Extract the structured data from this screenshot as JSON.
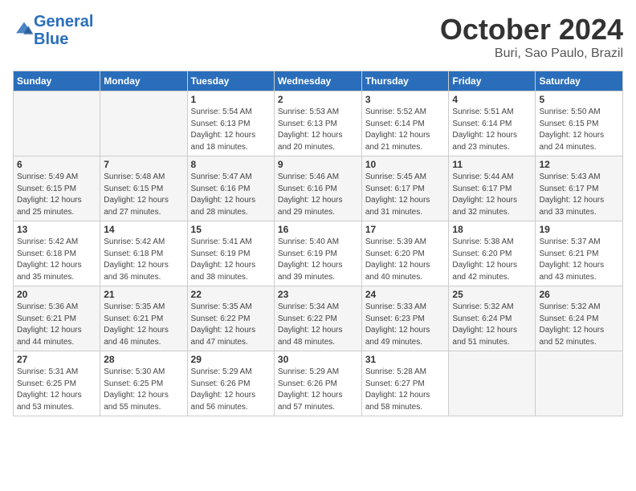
{
  "logo": {
    "line1": "General",
    "line2": "Blue"
  },
  "title": "October 2024",
  "subtitle": "Buri, Sao Paulo, Brazil",
  "days_of_week": [
    "Sunday",
    "Monday",
    "Tuesday",
    "Wednesday",
    "Thursday",
    "Friday",
    "Saturday"
  ],
  "weeks": [
    [
      {
        "num": "",
        "info": ""
      },
      {
        "num": "",
        "info": ""
      },
      {
        "num": "1",
        "info": "Sunrise: 5:54 AM\nSunset: 6:13 PM\nDaylight: 12 hours\nand 18 minutes."
      },
      {
        "num": "2",
        "info": "Sunrise: 5:53 AM\nSunset: 6:13 PM\nDaylight: 12 hours\nand 20 minutes."
      },
      {
        "num": "3",
        "info": "Sunrise: 5:52 AM\nSunset: 6:14 PM\nDaylight: 12 hours\nand 21 minutes."
      },
      {
        "num": "4",
        "info": "Sunrise: 5:51 AM\nSunset: 6:14 PM\nDaylight: 12 hours\nand 23 minutes."
      },
      {
        "num": "5",
        "info": "Sunrise: 5:50 AM\nSunset: 6:15 PM\nDaylight: 12 hours\nand 24 minutes."
      }
    ],
    [
      {
        "num": "6",
        "info": "Sunrise: 5:49 AM\nSunset: 6:15 PM\nDaylight: 12 hours\nand 25 minutes."
      },
      {
        "num": "7",
        "info": "Sunrise: 5:48 AM\nSunset: 6:15 PM\nDaylight: 12 hours\nand 27 minutes."
      },
      {
        "num": "8",
        "info": "Sunrise: 5:47 AM\nSunset: 6:16 PM\nDaylight: 12 hours\nand 28 minutes."
      },
      {
        "num": "9",
        "info": "Sunrise: 5:46 AM\nSunset: 6:16 PM\nDaylight: 12 hours\nand 29 minutes."
      },
      {
        "num": "10",
        "info": "Sunrise: 5:45 AM\nSunset: 6:17 PM\nDaylight: 12 hours\nand 31 minutes."
      },
      {
        "num": "11",
        "info": "Sunrise: 5:44 AM\nSunset: 6:17 PM\nDaylight: 12 hours\nand 32 minutes."
      },
      {
        "num": "12",
        "info": "Sunrise: 5:43 AM\nSunset: 6:17 PM\nDaylight: 12 hours\nand 33 minutes."
      }
    ],
    [
      {
        "num": "13",
        "info": "Sunrise: 5:42 AM\nSunset: 6:18 PM\nDaylight: 12 hours\nand 35 minutes."
      },
      {
        "num": "14",
        "info": "Sunrise: 5:42 AM\nSunset: 6:18 PM\nDaylight: 12 hours\nand 36 minutes."
      },
      {
        "num": "15",
        "info": "Sunrise: 5:41 AM\nSunset: 6:19 PM\nDaylight: 12 hours\nand 38 minutes."
      },
      {
        "num": "16",
        "info": "Sunrise: 5:40 AM\nSunset: 6:19 PM\nDaylight: 12 hours\nand 39 minutes."
      },
      {
        "num": "17",
        "info": "Sunrise: 5:39 AM\nSunset: 6:20 PM\nDaylight: 12 hours\nand 40 minutes."
      },
      {
        "num": "18",
        "info": "Sunrise: 5:38 AM\nSunset: 6:20 PM\nDaylight: 12 hours\nand 42 minutes."
      },
      {
        "num": "19",
        "info": "Sunrise: 5:37 AM\nSunset: 6:21 PM\nDaylight: 12 hours\nand 43 minutes."
      }
    ],
    [
      {
        "num": "20",
        "info": "Sunrise: 5:36 AM\nSunset: 6:21 PM\nDaylight: 12 hours\nand 44 minutes."
      },
      {
        "num": "21",
        "info": "Sunrise: 5:35 AM\nSunset: 6:21 PM\nDaylight: 12 hours\nand 46 minutes."
      },
      {
        "num": "22",
        "info": "Sunrise: 5:35 AM\nSunset: 6:22 PM\nDaylight: 12 hours\nand 47 minutes."
      },
      {
        "num": "23",
        "info": "Sunrise: 5:34 AM\nSunset: 6:22 PM\nDaylight: 12 hours\nand 48 minutes."
      },
      {
        "num": "24",
        "info": "Sunrise: 5:33 AM\nSunset: 6:23 PM\nDaylight: 12 hours\nand 49 minutes."
      },
      {
        "num": "25",
        "info": "Sunrise: 5:32 AM\nSunset: 6:24 PM\nDaylight: 12 hours\nand 51 minutes."
      },
      {
        "num": "26",
        "info": "Sunrise: 5:32 AM\nSunset: 6:24 PM\nDaylight: 12 hours\nand 52 minutes."
      }
    ],
    [
      {
        "num": "27",
        "info": "Sunrise: 5:31 AM\nSunset: 6:25 PM\nDaylight: 12 hours\nand 53 minutes."
      },
      {
        "num": "28",
        "info": "Sunrise: 5:30 AM\nSunset: 6:25 PM\nDaylight: 12 hours\nand 55 minutes."
      },
      {
        "num": "29",
        "info": "Sunrise: 5:29 AM\nSunset: 6:26 PM\nDaylight: 12 hours\nand 56 minutes."
      },
      {
        "num": "30",
        "info": "Sunrise: 5:29 AM\nSunset: 6:26 PM\nDaylight: 12 hours\nand 57 minutes."
      },
      {
        "num": "31",
        "info": "Sunrise: 5:28 AM\nSunset: 6:27 PM\nDaylight: 12 hours\nand 58 minutes."
      },
      {
        "num": "",
        "info": ""
      },
      {
        "num": "",
        "info": ""
      }
    ]
  ]
}
